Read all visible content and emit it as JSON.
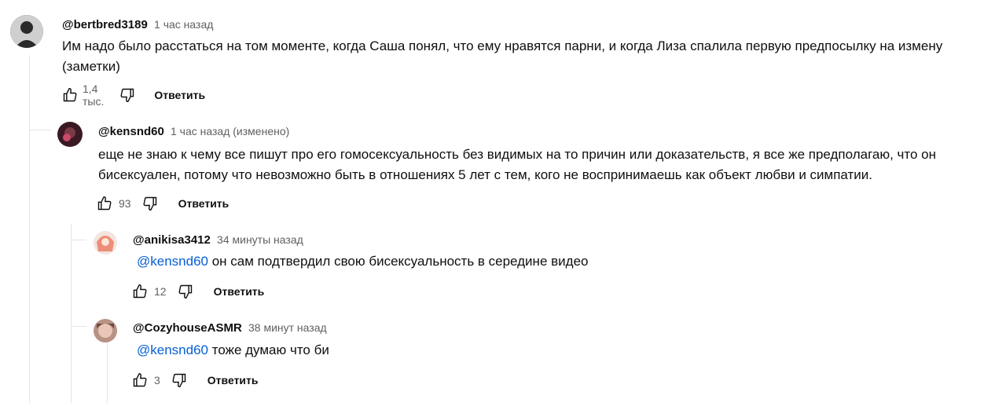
{
  "comments": [
    {
      "author": "@bertbred3189",
      "time": "1 час назад",
      "text": "Им надо было расстаться на том моменте, когда Саша понял, что ему нравятся парни, и когда Лиза спалила первую предпосылку на измену (заметки)",
      "likes": "1,4 тыс.",
      "reply_label": "Ответить",
      "avatar_color": "#3b3b3b"
    },
    {
      "author": "@kensnd60",
      "time": "1 час назад (изменено)",
      "text": "еще не знаю к чему все пишут про его гомосексуальность без видимых на то причин или доказательств, я все же предполагаю, что он бисексуален, потому что невозможно быть в отношениях 5 лет с тем, кого не воспринимаешь как объект любви и симпатии.",
      "likes": "93",
      "reply_label": "Ответить",
      "avatar_color": "#4a1f2a"
    },
    {
      "author": "@anikisa3412",
      "time": "34 минуты назад",
      "mention": "@kensnd60",
      "text": " он сам подтвердил свою бисексуальность в середине видео",
      "likes": "12",
      "reply_label": "Ответить",
      "avatar_color": "#e88b7a"
    },
    {
      "author": "@CozyhouseASMR",
      "time": "38 минут назад",
      "mention": "@kensnd60",
      "text": " тоже думаю что би",
      "likes": "3",
      "reply_label": "Ответить",
      "avatar_color": "#a8857a"
    }
  ]
}
